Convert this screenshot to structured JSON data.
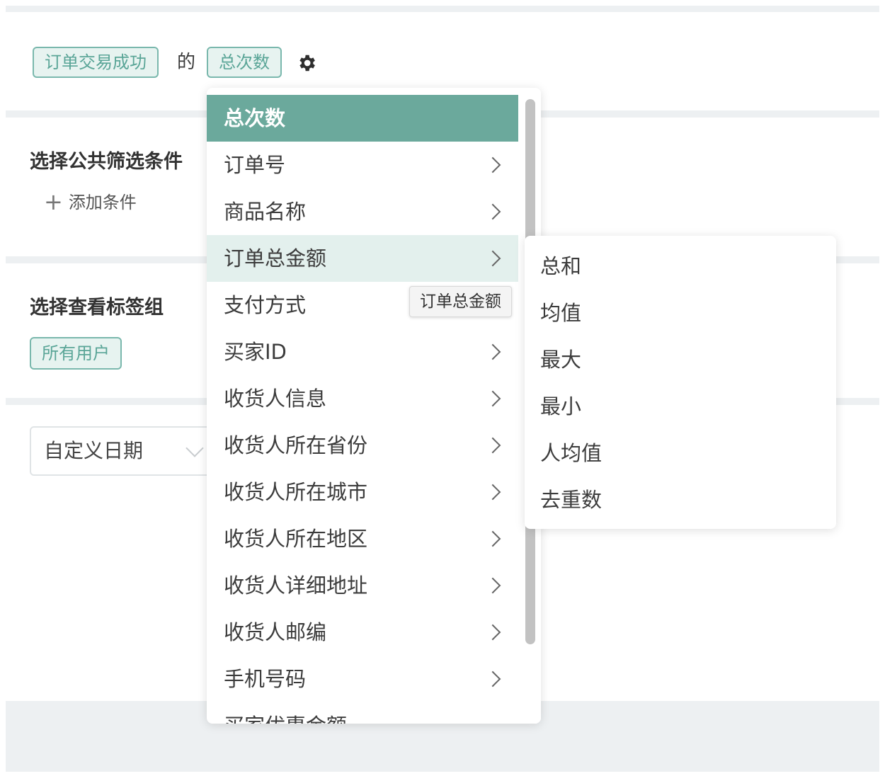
{
  "header": {
    "event_tag": "订单交易成功",
    "connector": "的",
    "metric_tag": "总次数"
  },
  "filter_section": {
    "title": "选择公共筛选条件",
    "add_condition": "添加条件"
  },
  "tag_group_section": {
    "title": "选择查看标签组",
    "selected_tag": "所有用户"
  },
  "date_select": {
    "value": "自定义日期"
  },
  "dropdown": {
    "items": [
      {
        "label": "总次数"
      },
      {
        "label": "订单号"
      },
      {
        "label": "商品名称"
      },
      {
        "label": "订单总金额"
      },
      {
        "label": "支付方式"
      },
      {
        "label": "买家ID"
      },
      {
        "label": "收货人信息"
      },
      {
        "label": "收货人所在省份"
      },
      {
        "label": "收货人所在城市"
      },
      {
        "label": "收货人所在地区"
      },
      {
        "label": "收货人详细地址"
      },
      {
        "label": "收货人邮编"
      },
      {
        "label": "手机号码"
      },
      {
        "label": "买家优惠金额"
      }
    ],
    "selected": "总次数",
    "hovered": "订单总金额",
    "tooltip": "订单总金额"
  },
  "submenu": {
    "items": [
      "总和",
      "均值",
      "最大",
      "最小",
      "人均值",
      "去重数"
    ]
  },
  "colors": {
    "accent": "#6ba99c",
    "tag_border": "#7ab8ad",
    "tag_bg": "#e7f3f0",
    "hover_bg": "#e3f0ed",
    "band_bg": "#edf0f2"
  }
}
